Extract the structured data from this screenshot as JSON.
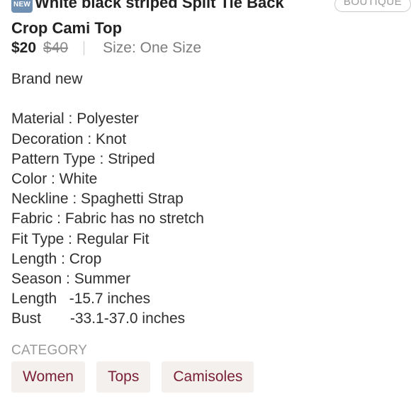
{
  "listing": {
    "new_badge": "NEW",
    "title": "White black striped Split Tie Back Crop Cami Top",
    "boutique_tag": "BOUTIQUE",
    "price": "$20",
    "original_price": "$40",
    "size": "Size: One Size"
  },
  "description": {
    "lines": [
      "Brand new",
      "",
      "Material : Polyester",
      "Decoration : Knot",
      "Pattern Type : Striped",
      "Color : White",
      "Neckline : Spaghetti Strap",
      "Fabric : Fabric has no stretch",
      "Fit Type : Regular Fit",
      "Length : Crop",
      "Season : Summer",
      "Length   -15.7 inches",
      "Bust       -33.1-37.0 inches"
    ]
  },
  "category": {
    "label": "CATEGORY",
    "chips": [
      "Women",
      "Tops",
      "Camisoles"
    ]
  },
  "colors": {
    "chip_text": "#7a2036",
    "chip_bg": "#f3f0ee",
    "new_badge_bg": "#6f8fb3"
  }
}
